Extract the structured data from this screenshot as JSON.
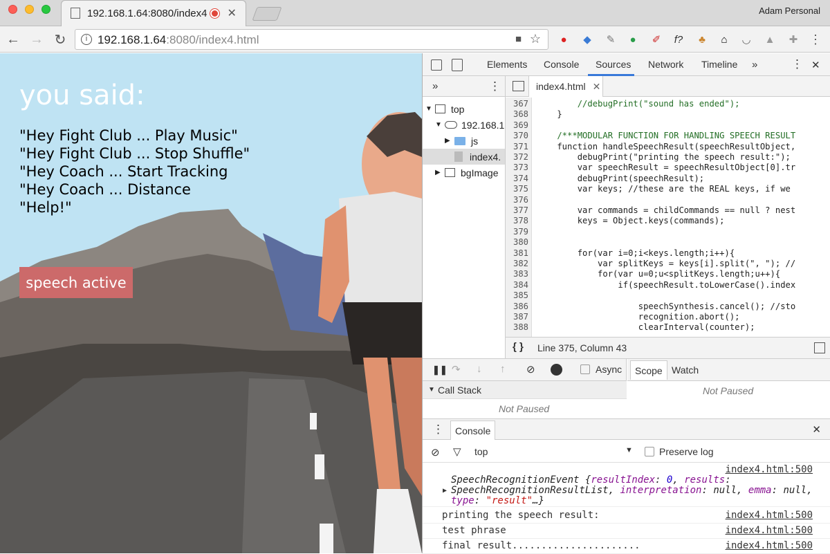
{
  "window": {
    "profile": "Adam Personal"
  },
  "tab": {
    "title": "192.168.1.64:8080/index4"
  },
  "address": {
    "host": "192.168.1.64",
    "rest": ":8080/index4.html"
  },
  "page": {
    "heading": "you said:",
    "commands": [
      "\"Hey Fight Club ... Play Music\"",
      "\"Hey Fight Club ... Stop Shuffle\"",
      "\"Hey Coach ... Start Tracking",
      "\"Hey Coach ... Distance",
      "\"Help!\""
    ],
    "speech_button": "speech active"
  },
  "devtools": {
    "tabs": [
      "Elements",
      "Console",
      "Sources",
      "Network",
      "Timeline"
    ],
    "active_tab": "Sources",
    "tree": {
      "top": "top",
      "host": "192.168.1",
      "js": "js",
      "file": "index4.",
      "bg": "bgImage"
    },
    "editor_tab": "index4.html",
    "status": "Line 375, Column 43",
    "code": [
      {
        "n": "367",
        "t": "        //debugPrint(\"sound has ended\");"
      },
      {
        "n": "368",
        "t": "    }"
      },
      {
        "n": "369",
        "t": ""
      },
      {
        "n": "370",
        "t": "    /***MODULAR FUNCTION FOR HANDLING SPEECH RESULT"
      },
      {
        "n": "371",
        "t": "    function handleSpeechResult(speechResultObject,"
      },
      {
        "n": "372",
        "t": "        debugPrint(\"printing the speech result:\");"
      },
      {
        "n": "373",
        "t": "        var speechResult = speechResultObject[0].tr"
      },
      {
        "n": "374",
        "t": "        debugPrint(speechResult);"
      },
      {
        "n": "375",
        "t": "        var keys; //these are the REAL keys, if we"
      },
      {
        "n": "376",
        "t": ""
      },
      {
        "n": "377",
        "t": "        var commands = childCommands == null ? nest"
      },
      {
        "n": "378",
        "t": "        keys = Object.keys(commands);"
      },
      {
        "n": "379",
        "t": ""
      },
      {
        "n": "380",
        "t": ""
      },
      {
        "n": "381",
        "t": "        for(var i=0;i<keys.length;i++){"
      },
      {
        "n": "382",
        "t": "            var splitKeys = keys[i].split(\", \"); //"
      },
      {
        "n": "383",
        "t": "            for(var u=0;u<splitKeys.length;u++){"
      },
      {
        "n": "384",
        "t": "                if(speechResult.toLowerCase().index"
      },
      {
        "n": "385",
        "t": ""
      },
      {
        "n": "386",
        "t": "                    speechSynthesis.cancel(); //sto"
      },
      {
        "n": "387",
        "t": "                    recognition.abort();"
      },
      {
        "n": "388",
        "t": "                    clearInterval(counter);"
      }
    ],
    "debugger": {
      "async": "Async",
      "call_stack": "Call Stack",
      "not_paused": "Not Paused",
      "scope": "Scope",
      "watch": "Watch",
      "scope_not_paused": "Not Paused"
    },
    "console": {
      "tab": "Console",
      "context": "top",
      "preserve": "Preserve log",
      "event_line1_name": "SpeechRecognitionEvent ",
      "event_line1_pre": "{",
      "event_k1": "resultIndex",
      "event_v1": "0",
      "event_k2": "results",
      "event_line2": "SpeechRecognitionResultList",
      "event_k3": "interpretation",
      "event_v3": "null",
      "event_k4": "emma",
      "event_v4": "null",
      "event_k5": "type",
      "event_v5": "\"result\"",
      "event_tail": "…}",
      "messages": [
        "printing the speech result:",
        "test phrase",
        "final result......................"
      ],
      "source": "index4.html:500"
    }
  },
  "colors": {
    "speech_button": "#cc6a6a",
    "devtools_accent": "#3879d9",
    "sky": "#bfe3f3"
  }
}
